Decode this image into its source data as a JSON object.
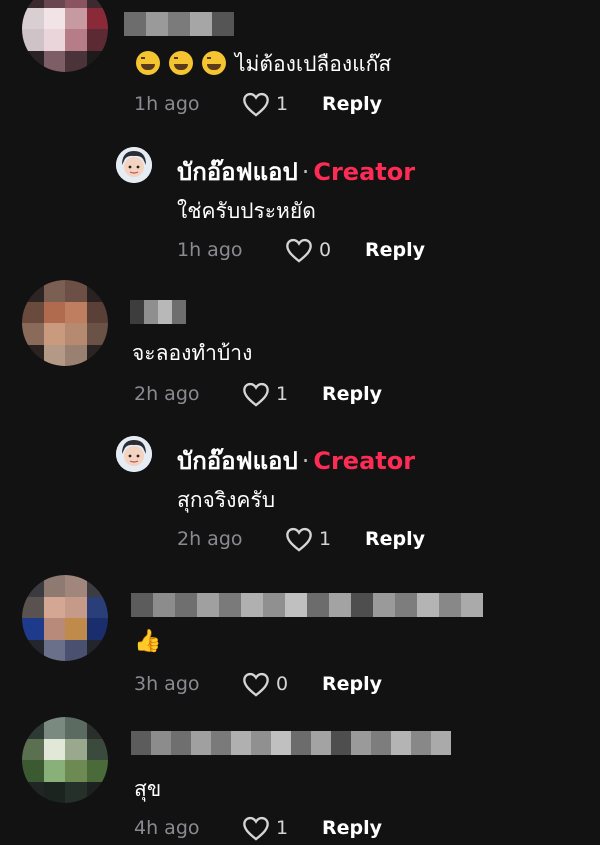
{
  "comments": [
    {
      "text": "ไม่ต้องเปลืองแก๊ส",
      "emoji_names": [
        "grinning-sweat-emoji",
        "grinning-sweat-emoji",
        "grinning-sweat-emoji"
      ],
      "time": "1h ago",
      "likes": "1",
      "reply_label": "Reply"
    },
    {
      "username": "บักอ๊อฟแอป",
      "separator": "·",
      "badge": "Creator",
      "text": "ใช่ครับประหยัด",
      "time": "1h ago",
      "likes": "0",
      "reply_label": "Reply"
    },
    {
      "text": "จะลองทำบ้าง",
      "time": "2h ago",
      "likes": "1",
      "reply_label": "Reply"
    },
    {
      "username": "บักอ๊อฟแอป",
      "separator": "·",
      "badge": "Creator",
      "text": "สุกจริงครับ",
      "time": "2h ago",
      "likes": "1",
      "reply_label": "Reply"
    },
    {
      "text": "👍",
      "time": "3h ago",
      "likes": "0",
      "reply_label": "Reply"
    },
    {
      "text": "สุข",
      "time": "4h ago",
      "likes": "1",
      "reply_label": "Reply"
    }
  ],
  "colors": {
    "background": "#121212",
    "creator_badge": "#fe2c55",
    "timestamp": "#8a8b91",
    "heart_outline": "#d5d5d5"
  },
  "icons": {
    "like": "heart-outline-icon"
  }
}
